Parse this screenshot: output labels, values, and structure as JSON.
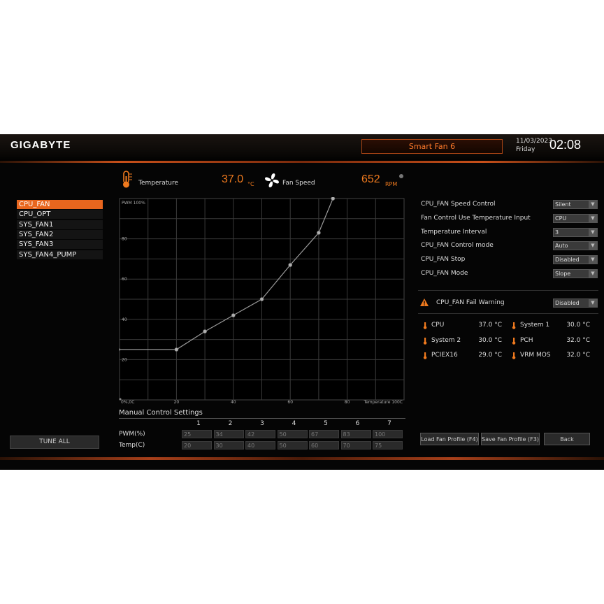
{
  "header": {
    "logo": "GIGABYTE",
    "title": "Smart Fan 6",
    "date": "11/03/2023",
    "day": "Friday",
    "time": "02:08"
  },
  "fan_list": [
    {
      "label": "CPU_FAN",
      "selected": true
    },
    {
      "label": "CPU_OPT",
      "selected": false
    },
    {
      "label": "SYS_FAN1",
      "selected": false
    },
    {
      "label": "SYS_FAN2",
      "selected": false
    },
    {
      "label": "SYS_FAN3",
      "selected": false
    },
    {
      "label": "SYS_FAN4_PUMP",
      "selected": false
    }
  ],
  "tune_all_label": "TUNE ALL",
  "readouts": {
    "temperature_label": "Temperature",
    "temperature_value": "37.0",
    "temperature_unit": "°C",
    "fan_speed_label": "Fan Speed",
    "fan_speed_value": "652",
    "fan_speed_unit": "RPM"
  },
  "chart_data": {
    "type": "line",
    "x_axis_label": "Temperature 100C",
    "x_origin_label": "0%,0C",
    "y_axis_label": "PWM 100%",
    "xlim": [
      0,
      100
    ],
    "ylim": [
      0,
      100
    ],
    "x_ticks": [
      20,
      40,
      60,
      80
    ],
    "y_ticks": [
      20,
      40,
      60,
      80
    ],
    "grid": true,
    "points": [
      {
        "x": 20,
        "y": 25
      },
      {
        "x": 30,
        "y": 34
      },
      {
        "x": 40,
        "y": 42
      },
      {
        "x": 50,
        "y": 50
      },
      {
        "x": 60,
        "y": 67
      },
      {
        "x": 70,
        "y": 83
      },
      {
        "x": 75,
        "y": 100
      }
    ],
    "start": {
      "x": 0,
      "y": 25
    },
    "colors": {
      "line": "#9a9a9a",
      "grid": "#3a3a3a",
      "point": "#b0b0b0"
    }
  },
  "manual": {
    "title": "Manual Control Settings",
    "columns": [
      "1",
      "2",
      "3",
      "4",
      "5",
      "6",
      "7"
    ],
    "pwm_label": "PWM(%)",
    "temp_label": "Temp(C)",
    "pwm": [
      "25",
      "34",
      "42",
      "50",
      "67",
      "83",
      "100"
    ],
    "temp": [
      "20",
      "30",
      "40",
      "50",
      "60",
      "70",
      "75"
    ]
  },
  "settings": [
    {
      "label": "CPU_FAN Speed Control",
      "value": "Silent"
    },
    {
      "label": "Fan Control Use Temperature Input",
      "value": "CPU"
    },
    {
      "label": "Temperature Interval",
      "value": "3"
    },
    {
      "label": "CPU_FAN Control mode",
      "value": "Auto"
    },
    {
      "label": "CPU_FAN Stop",
      "value": "Disabled"
    },
    {
      "label": "CPU_FAN Mode",
      "value": "Slope"
    }
  ],
  "fail_warning": {
    "label": "CPU_FAN Fail Warning",
    "value": "Disabled"
  },
  "temps": [
    {
      "label": "CPU",
      "value": "37.0 °C"
    },
    {
      "label": "System 1",
      "value": "30.0 °C"
    },
    {
      "label": "System 2",
      "value": "30.0 °C"
    },
    {
      "label": "PCH",
      "value": "32.0 °C"
    },
    {
      "label": "PCIEX16",
      "value": "29.0 °C"
    },
    {
      "label": "VRM MOS",
      "value": "32.0 °C"
    }
  ],
  "buttons": {
    "load": "Load Fan Profile (F4)",
    "save": "Save Fan Profile (F3)",
    "back": "Back"
  },
  "accent_color": "#f07a1e"
}
